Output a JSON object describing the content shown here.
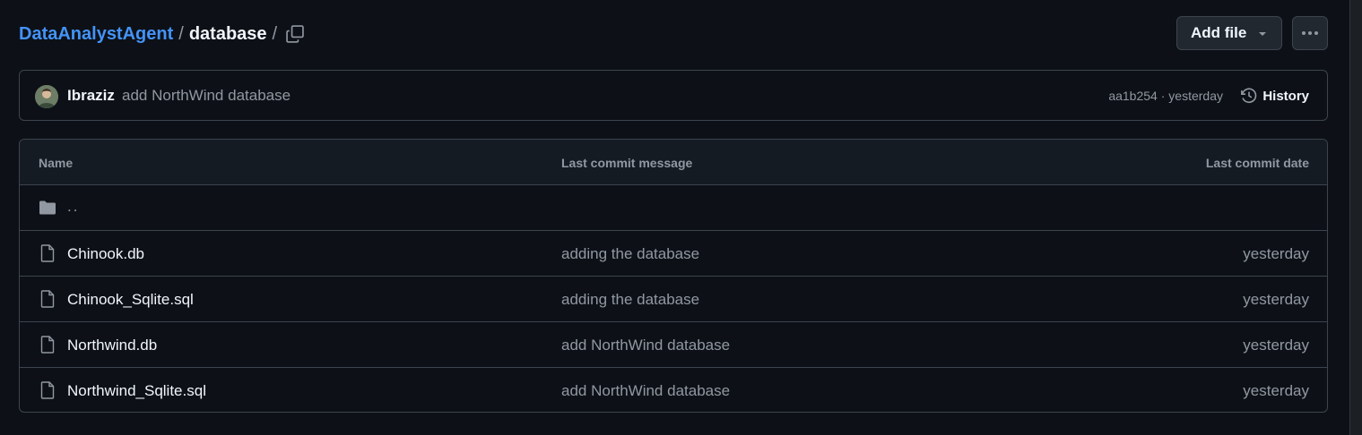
{
  "breadcrumb": {
    "repo": "DataAnalystAgent",
    "separator": "/",
    "current": "database",
    "trailing_separator": "/"
  },
  "actions": {
    "add_file_label": "Add file",
    "more_icon": "kebab-horizontal-icon",
    "copy_icon": "copy-icon"
  },
  "commit": {
    "author": "Ibraziz",
    "message": "add NorthWind database",
    "sha": "aa1b254",
    "dot": "·",
    "when": "yesterday",
    "history_label": "History"
  },
  "table": {
    "headers": {
      "name": "Name",
      "message": "Last commit message",
      "date": "Last commit date"
    },
    "parent": {
      "label": "..",
      "icon": "folder-icon"
    },
    "rows": [
      {
        "name": "Chinook.db",
        "message": "adding the database",
        "date": "yesterday",
        "icon": "file-icon"
      },
      {
        "name": "Chinook_Sqlite.sql",
        "message": "adding the database",
        "date": "yesterday",
        "icon": "file-icon"
      },
      {
        "name": "Northwind.db",
        "message": "add NorthWind database",
        "date": "yesterday",
        "icon": "file-icon"
      },
      {
        "name": "Northwind_Sqlite.sql",
        "message": "add NorthWind database",
        "date": "yesterday",
        "icon": "file-icon"
      }
    ]
  },
  "colors": {
    "background": "#0d1117",
    "link": "#4493f8",
    "border": "#3d444d",
    "muted": "#9198a1",
    "text": "#f0f6fc"
  }
}
